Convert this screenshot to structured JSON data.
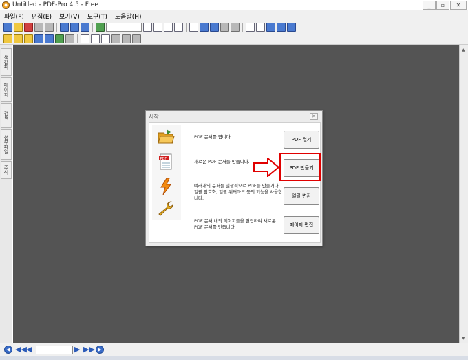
{
  "window": {
    "title": "Untitled - PDF-Pro 4.5 - Free",
    "min_label": "_",
    "max_label": "▫",
    "close_label": "✕"
  },
  "menu": [
    "파일(F)",
    "편집(E)",
    "보기(V)",
    "도구(T)",
    "도움말(H)"
  ],
  "toolbar1_icons": [
    "new-icon",
    "open-icon",
    "save-icon",
    "print-icon",
    "scan-icon",
    "export-icon",
    "image-icon",
    "convert-icon",
    "bookmark-icon",
    "page-first-icon",
    "page-prev-icon",
    "page-next-icon",
    "page-last-icon",
    "hand-icon",
    "zoom-in-icon",
    "zoom-out-icon",
    "snapshot-icon",
    "fit-page-icon",
    "fit-width-icon",
    "single-page-icon",
    "two-page-icon",
    "rotate-icon",
    "flip-icon"
  ],
  "toolbar2_icons": [
    "stamp-icon",
    "folder-icon",
    "text-icon",
    "text-box-icon",
    "table-icon",
    "highlight-icon",
    "underline-icon",
    "select-icon",
    "crop-icon",
    "text-select-icon",
    "pin-icon",
    "link-icon",
    "attach-icon"
  ],
  "side_tabs": [
    "책갈피",
    "페이지",
    "검색",
    "첨부파일",
    "주석"
  ],
  "colors": {
    "workspace": "#545454",
    "highlight": "#e00000",
    "nav_blue": "#3a6cc8"
  },
  "dialog": {
    "title": "시작",
    "close_label": "✕",
    "items": [
      {
        "icon": "open-folder-icon",
        "desc": "PDF 문서를 엽니다.",
        "button": "PDF 열기"
      },
      {
        "icon": "pdf-document-icon",
        "desc": "새로운 PDF 문서를 만듭니다.",
        "button": "PDF 만들기"
      },
      {
        "icon": "lightning-icon",
        "desc": "여러개의 문서를 일괄적으로 PDF를 만들거나, 일괄 암호화, 일괄 워터마크 등의 기능을 사용합니다.",
        "button": "일괄 변환"
      },
      {
        "icon": "wrench-icon",
        "desc": "PDF 문서 내의 페이지들을 편집하여 새로운 PDF 문서를 만듭니다.",
        "button": "페이지 편집"
      }
    ]
  },
  "nav": {
    "page_value": ""
  }
}
